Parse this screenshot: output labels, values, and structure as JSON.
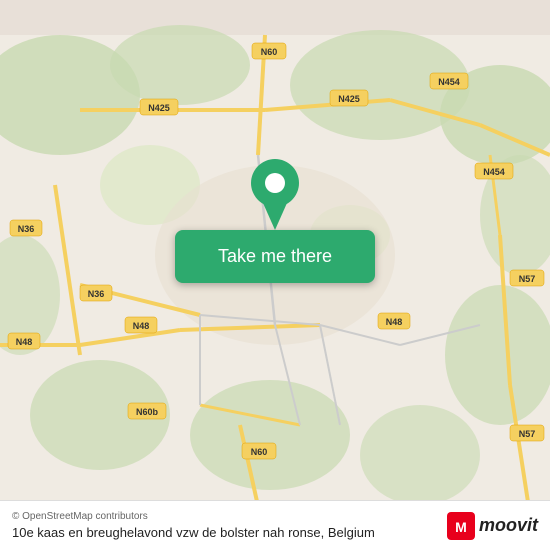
{
  "map": {
    "attribution": "© OpenStreetMap contributors",
    "location_name": "10e kaas en breughelavond vzw de bolster nah ronse, Belgium"
  },
  "action_button": {
    "label": "Take me there"
  },
  "branding": {
    "moovit_label": "moovit"
  },
  "road_labels": {
    "n60_top": "N60",
    "n454_top": "N454",
    "n425_left": "N425",
    "n425_right": "N425",
    "n454_right": "N454",
    "n36_left": "N36",
    "n36_mid": "N36",
    "n48_left": "N48",
    "n48_mid": "N48",
    "n60b": "N60b",
    "n60_bottom": "N60",
    "n57_right": "N57",
    "n57_bottom": "N57"
  }
}
